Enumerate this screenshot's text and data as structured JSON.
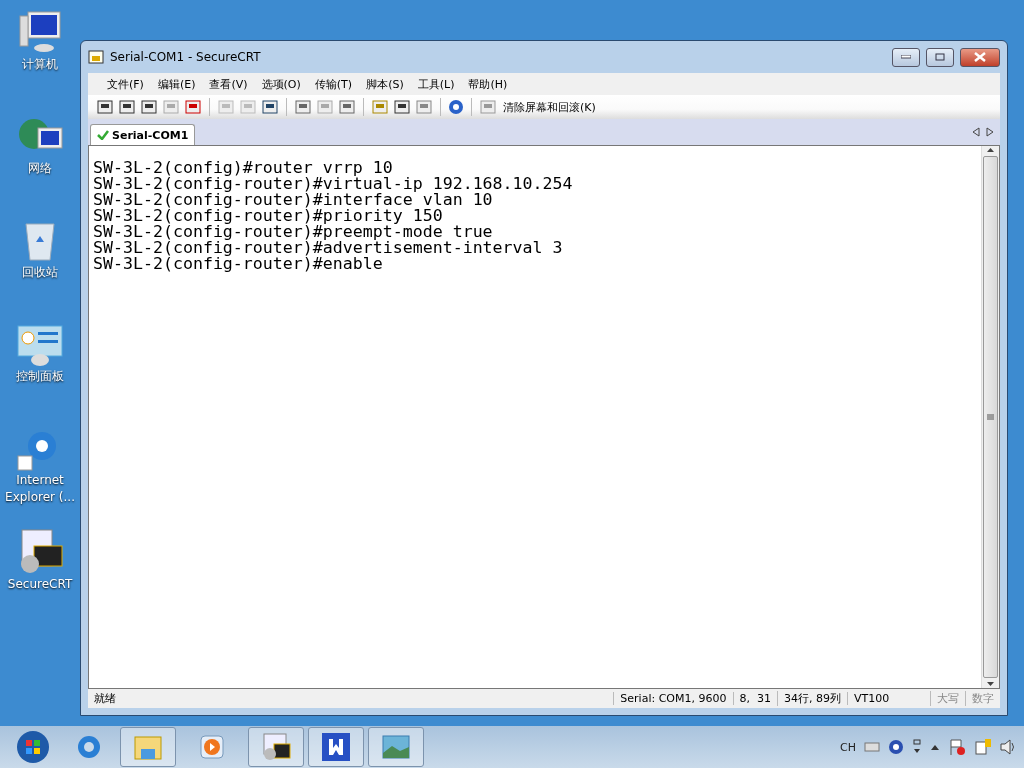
{
  "desktop_icons": [
    {
      "label": "计算机",
      "kind": "computer"
    },
    {
      "label": "网络",
      "kind": "network"
    },
    {
      "label": "回收站",
      "kind": "recycle"
    },
    {
      "label": "控制面板",
      "kind": "control"
    },
    {
      "label": "Internet Explorer (...",
      "kind": "ie"
    },
    {
      "label": "SecureCRT",
      "kind": "crt"
    }
  ],
  "window": {
    "title": "Serial-COM1 - SecureCRT"
  },
  "menu": [
    "文件(F)",
    "编辑(E)",
    "查看(V)",
    "选项(O)",
    "传输(T)",
    "脚本(S)",
    "工具(L)",
    "帮助(H)"
  ],
  "toolbar": {
    "clear_button": "清除屏幕和回滚(K)"
  },
  "tabs": [
    {
      "label": "Serial-COM1",
      "selected": true
    }
  ],
  "terminal": {
    "lines": [
      "SW-3L-2(config)#router vrrp 10",
      "SW-3L-2(config-router)#virtual-ip 192.168.10.254",
      "SW-3L-2(config-router)#interface vlan 10",
      "SW-3L-2(config-router)#priority 150",
      "SW-3L-2(config-router)#preempt-mode true",
      "SW-3L-2(config-router)#advertisement-interval 3",
      "SW-3L-2(config-router)#enable"
    ]
  },
  "status_bar": {
    "status": "就绪",
    "connection": "Serial: COM1, 9600",
    "cursor": "8,  31",
    "size": "34行, 89列",
    "emulation": "VT100",
    "caps": "大写",
    "num": "数字"
  },
  "taskbar": {
    "language": "CH"
  }
}
